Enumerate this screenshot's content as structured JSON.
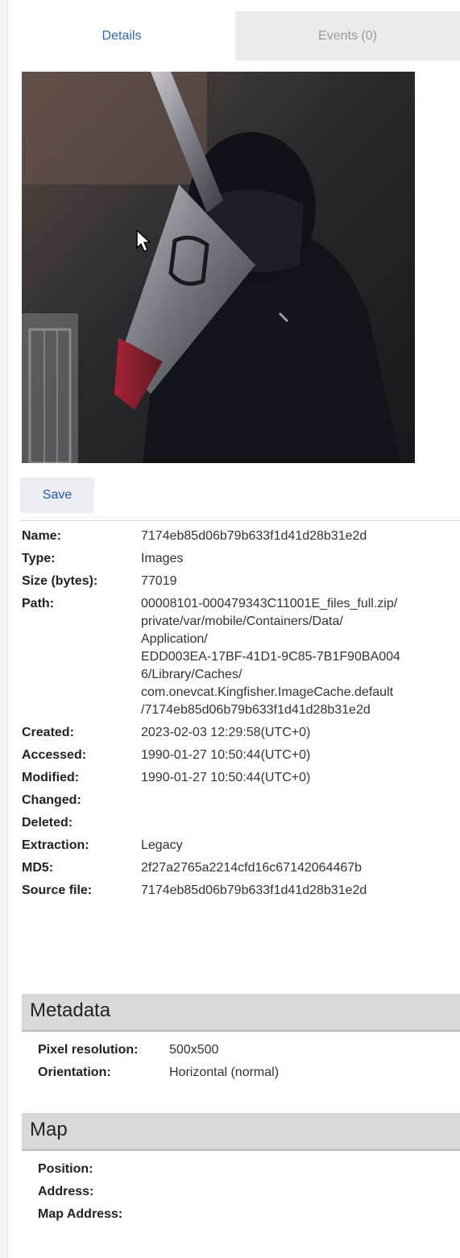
{
  "tabs": [
    {
      "label": "Details"
    },
    {
      "label": "Events (0)"
    }
  ],
  "toolbar": {
    "save_label": "Save"
  },
  "details": {
    "name_label": "Name:",
    "name_value": "7174eb85d06b79b633f1d41d28b31e2d",
    "type_label": "Type:",
    "type_value": "Images",
    "size_label": "Size (bytes):",
    "size_value": "77019",
    "path_label": "Path:",
    "path_lines": [
      "00008101-000479343C11001E_files_full.zip/",
      "private/var/mobile/Containers/Data/",
      "Application/",
      "EDD003EA-17BF-41D1-9C85-7B1F90BA004",
      "6/Library/Caches/",
      "com.onevcat.Kingfisher.ImageCache.default",
      "/7174eb85d06b79b633f1d41d28b31e2d"
    ],
    "created_label": "Created:",
    "created_value": "2023-02-03 12:29:58(UTC+0)",
    "accessed_label": "Accessed:",
    "accessed_value": "1990-01-27 10:50:44(UTC+0)",
    "modified_label": "Modified:",
    "modified_value": "1990-01-27 10:50:44(UTC+0)",
    "changed_label": "Changed:",
    "changed_value": "",
    "deleted_label": "Deleted:",
    "deleted_value": "",
    "extraction_label": "Extraction:",
    "extraction_value": "Legacy",
    "md5_label": "MD5:",
    "md5_value": "2f27a2765a2214cfd16c67142064467b",
    "source_label": "Source file:",
    "source_value": "7174eb85d06b79b633f1d41d28b31e2d"
  },
  "metadata": {
    "title": "Metadata",
    "resolution_label": "Pixel resolution:",
    "resolution_value": "500x500",
    "orientation_label": "Orientation:",
    "orientation_value": "Horizontal (normal)"
  },
  "map": {
    "title": "Map",
    "position_label": "Position:",
    "position_value": "",
    "address_label": "Address:",
    "address_value": "",
    "map_address_label": "Map Address:",
    "map_address_value": ""
  },
  "icons": {
    "cursor": "mouse-pointer-icon"
  },
  "colors": {
    "accent": "#2a6bb3",
    "save_text": "#2456a5",
    "section_bg": "#d9d9d9",
    "inactive_tab_bg": "#ebebeb"
  }
}
